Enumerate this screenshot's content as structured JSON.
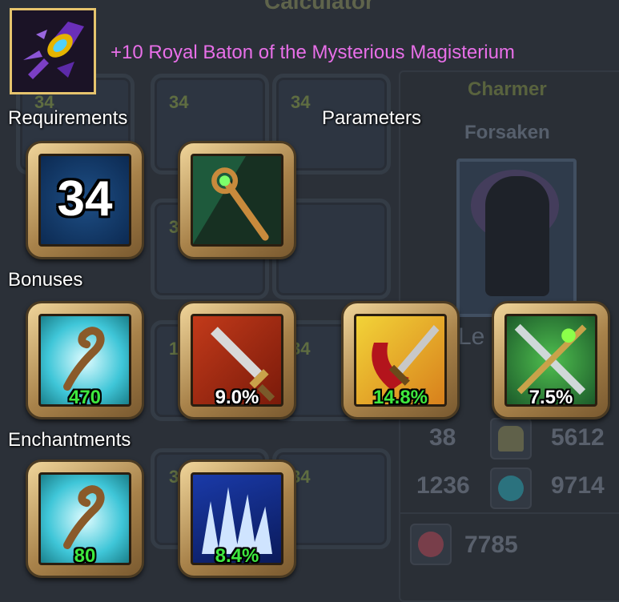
{
  "background": {
    "title": "Calculator",
    "slot_levels": [
      "34",
      "34",
      "34",
      "3",
      "1",
      "34",
      "34",
      "3"
    ],
    "character": {
      "class": "Charmer",
      "race": "Forsaken",
      "level_label_partial": "Le",
      "stats": [
        {
          "value": "38",
          "icon": "body-icon"
        },
        {
          "value": "5612"
        },
        {
          "value": "1236",
          "icon": "swirl-icon"
        },
        {
          "value": "9714"
        },
        {
          "value": "7785",
          "icon": "health-cross-icon"
        }
      ]
    }
  },
  "item": {
    "icon": "royal-baton-icon",
    "name": "+10 Royal Baton of the Mysterious Magisterium",
    "name_color": "#e86fe8"
  },
  "sections": {
    "requirements": "Requirements",
    "parameters": "Parameters",
    "bonuses": "Bonuses",
    "enchantments": "Enchantments"
  },
  "requirements": [
    {
      "icon": "level-icon",
      "value": "34"
    }
  ],
  "parameters": [
    {
      "icon": "staff-icon"
    }
  ],
  "bonuses": [
    {
      "icon": "magic-staff-icon",
      "value": "470",
      "color": "#3ee83e"
    },
    {
      "icon": "sword-icon",
      "value": "9.0%",
      "color": "#ffffff"
    },
    {
      "icon": "crit-sword-icon",
      "value": "14.8%",
      "color": "#3ee83e"
    },
    {
      "icon": "crossed-weapons-icon",
      "value": "7.5%",
      "color": "#ffffff"
    }
  ],
  "enchantments": [
    {
      "icon": "magic-staff-icon",
      "value": "80",
      "color": "#3ee83e"
    },
    {
      "icon": "ice-spikes-icon",
      "value": "8.4%",
      "color": "#3ee83e"
    }
  ]
}
